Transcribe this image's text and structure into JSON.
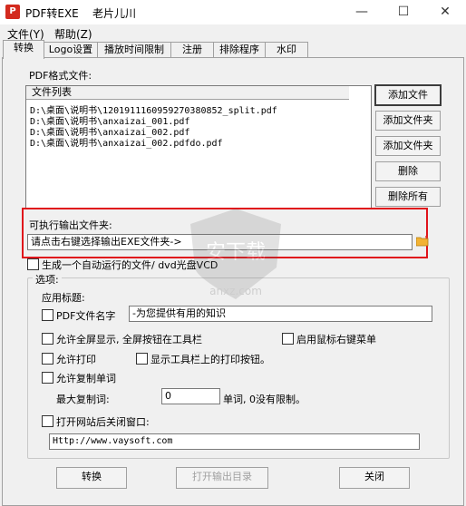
{
  "window": {
    "title": "PDF转EXE",
    "subtitle": "老片儿川"
  },
  "menu": [
    {
      "label": "文件(Y)"
    },
    {
      "label": "帮助(Z)"
    }
  ],
  "tabs": [
    {
      "label": "转换"
    },
    {
      "label": "Logo设置"
    },
    {
      "label": "播放时间限制"
    },
    {
      "label": "注册"
    },
    {
      "label": "排除程序"
    },
    {
      "label": "水印"
    }
  ],
  "pdf_section": {
    "label": "PDF格式文件:",
    "list_header": "文件列表",
    "files": [
      "D:\\桌面\\说明书\\1201911160959270380852_split.pdf",
      "D:\\桌面\\说明书\\anxaizai_001.pdf",
      "D:\\桌面\\说明书\\anxaizai_002.pdf",
      "D:\\桌面\\说明书\\anxaizai_002.pdfdo.pdf"
    ],
    "buttons": {
      "add_file": "添加文件",
      "add_folder_1": "添加文件夹",
      "add_folder_2": "添加文件夹",
      "delete": "删除",
      "delete_all": "删除所有"
    }
  },
  "output": {
    "label": "可执行输出文件夹:",
    "value": "请点击右键选择输出EXE文件夹->",
    "autorun_label": "生成一个自动运行的文件/ dvd光盘VCD"
  },
  "options": {
    "legend": "选项:",
    "app_title_label": "应用标题:",
    "pdf_name_label": "PDF文件名字",
    "pdf_name_value": "-为您提供有用的知识",
    "fullscreen_label": "允许全屏显示, 全屏按钮在工具栏",
    "right_click_label": "启用鼠标右键菜单",
    "allow_print_label": "允许打印",
    "show_print_btn_label": "显示工具栏上的打印按钮。",
    "allow_copy_label": "允许复制单词",
    "max_copy_label": "最大复制词:",
    "max_copy_value": "0",
    "max_copy_hint": "单词, 0没有限制。",
    "open_site_label": "打开网站后关闭窗口:",
    "site_url": "Http://www.vaysoft.com"
  },
  "footer": {
    "convert": "转换",
    "open_output": "打开输出目录",
    "close": "关闭"
  },
  "watermark": {
    "text": "安下载",
    "sub": "anxz.com"
  }
}
